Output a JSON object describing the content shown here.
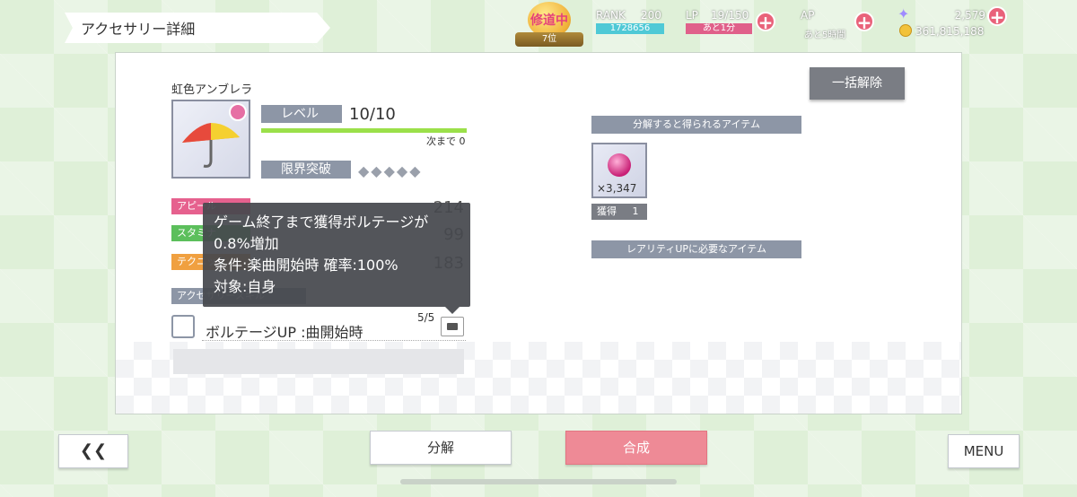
{
  "header": {
    "title": "アクセサリー詳細",
    "event_badge": "修道中",
    "event_rank": "7位",
    "rank_label": "RANK",
    "rank_value": "200",
    "rank_exp": "1728656",
    "lp_label": "LP",
    "lp_value": "19/150",
    "lp_sub": "あと1分",
    "ap_label": "AP",
    "ap_sub": "あと5時間",
    "stars": "2,579",
    "gold": "361,815,188"
  },
  "accessory": {
    "name": "虹色アンブレラ",
    "level_label": "レベル",
    "level_value": "10/10",
    "next_label": "次まで",
    "next_value": "0",
    "limit_break_label": "限界突破",
    "limit_break_marks": "◆◆◆◆◆",
    "stats": [
      {
        "label": "アピール",
        "value": "214",
        "color": "#e6618e"
      },
      {
        "label": "スタミナ",
        "value": "99",
        "color": "#5cbf5c"
      },
      {
        "label": "テクニック",
        "value": "183",
        "color": "#f0a040"
      }
    ],
    "skill_header": "アクセサリースキル",
    "skill_name": "ボルテージUP :曲開始時",
    "skill_level": "5/5"
  },
  "tooltip": {
    "line1": "ゲーム終了まで獲得ボルテージが",
    "line2": "0.8%増加",
    "line3": "条件:楽曲開始時 確率:100%",
    "line4": "対象:自身"
  },
  "right": {
    "bulk_button": "一括解除",
    "dismantle_header": "分解すると得られるアイテム",
    "material_qty": "×3,347",
    "obtain_label": "獲得",
    "obtain_value": "1",
    "rarity_header": "レアリティUPに必要なアイテム"
  },
  "footer": {
    "back_label": "❮❮",
    "dismantle_label": "分解",
    "fuse_label": "合成",
    "menu_label": "MENU"
  }
}
